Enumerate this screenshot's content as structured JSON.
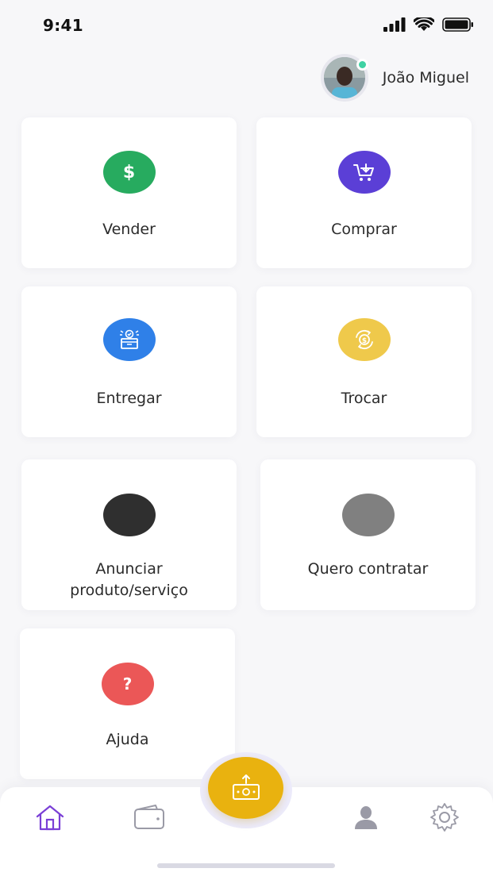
{
  "status_bar": {
    "time": "9:41"
  },
  "profile": {
    "name": "João Miguel"
  },
  "cards": [
    {
      "id": "vender",
      "label": "Vender",
      "icon": "dollar-icon",
      "color": "#27ab5f"
    },
    {
      "id": "comprar",
      "label": "Comprar",
      "icon": "cart-icon",
      "color": "#5b3fd6"
    },
    {
      "id": "entregar",
      "label": "Entregar",
      "icon": "delivery-box-icon",
      "color": "#2f80e8"
    },
    {
      "id": "trocar",
      "label": "Trocar",
      "icon": "exchange-icon",
      "color": "#efc94b"
    },
    {
      "id": "anunciar",
      "label_line1": "Anunciar",
      "label_line2": "produto/serviço",
      "icon": "placeholder-circle",
      "color": "#2f2f2f"
    },
    {
      "id": "contratar",
      "label": "Quero contratar",
      "icon": "placeholder-circle",
      "color": "#808080"
    },
    {
      "id": "ajuda",
      "label": "Ajuda",
      "icon": "question-icon",
      "color": "#eb5757"
    }
  ],
  "bottom_nav": {
    "items": [
      "home-icon",
      "wallet-icon",
      "money-transfer-icon",
      "user-icon",
      "settings-icon"
    ],
    "active": "home-icon",
    "active_color": "#7a3fd6",
    "fab_color": "#e9b20f"
  }
}
